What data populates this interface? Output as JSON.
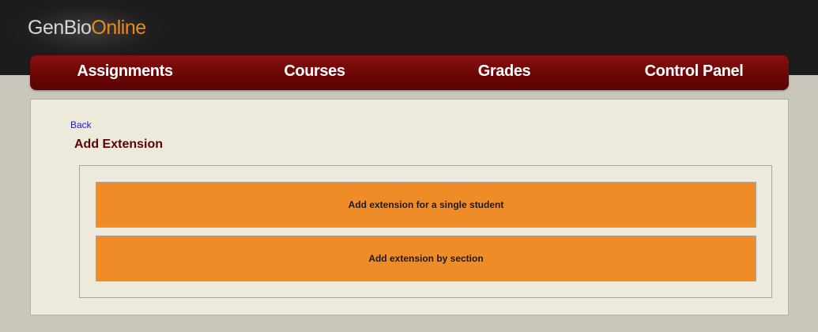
{
  "brand": {
    "logo_part1": "GenBio",
    "logo_part2": "Online"
  },
  "nav": {
    "items": [
      {
        "label": "Assignments"
      },
      {
        "label": "Courses"
      },
      {
        "label": "Grades"
      },
      {
        "label": "Control Panel"
      }
    ]
  },
  "page": {
    "back_label": "Back",
    "title": "Add Extension"
  },
  "options": [
    {
      "label": "Add extension for a single student"
    },
    {
      "label": "Add extension by section"
    }
  ],
  "colors": {
    "nav_bg": "#6b0606",
    "accent_orange": "#f08c28",
    "title_color": "#5a0404",
    "content_bg": "#eeeadb",
    "page_bg": "#c9c7bb",
    "topbar_bg": "#1c1c1c"
  }
}
